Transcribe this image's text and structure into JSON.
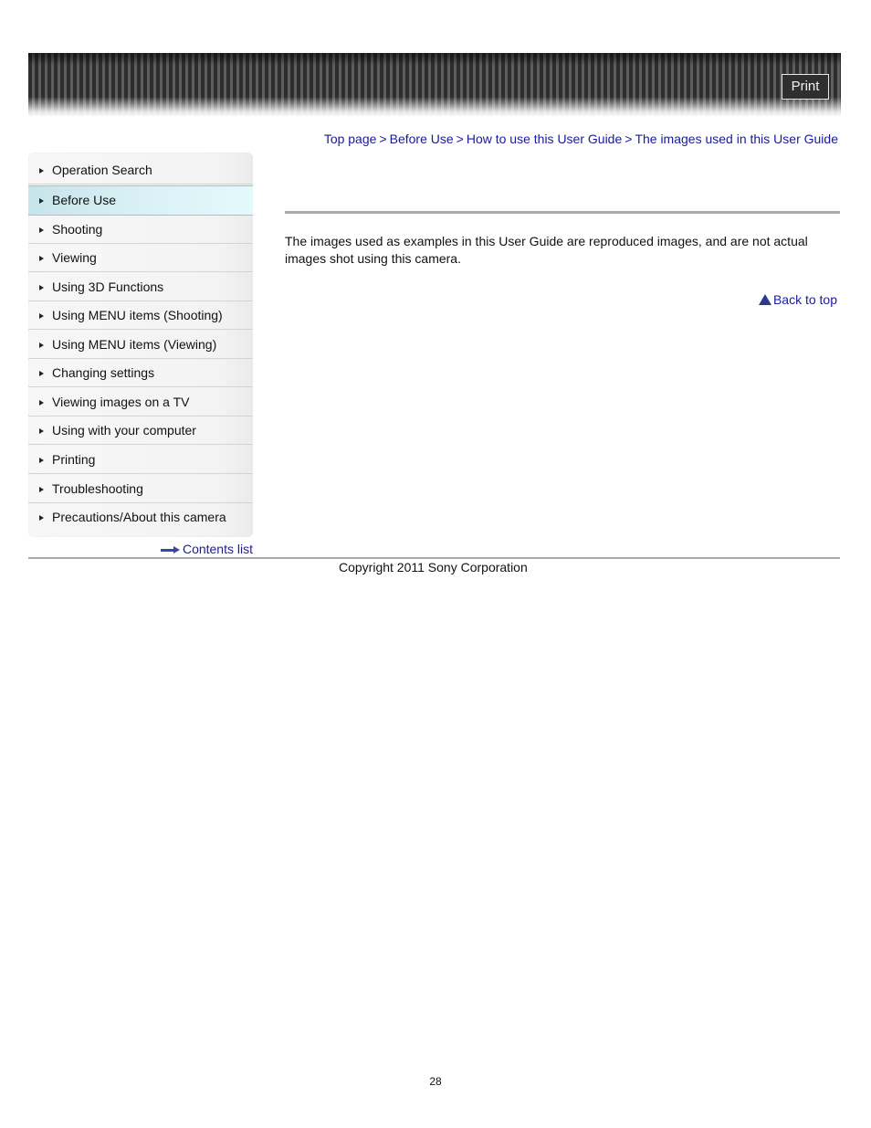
{
  "header": {
    "print_label": "Print"
  },
  "breadcrumb": {
    "items": [
      {
        "label": "Top page"
      },
      {
        "label": "Before Use"
      },
      {
        "label": "How to use this User Guide"
      },
      {
        "label": "The images used in this User Guide"
      }
    ],
    "separator": ">"
  },
  "sidebar": {
    "active_index": 1,
    "items": [
      {
        "label": "Operation Search"
      },
      {
        "label": "Before Use"
      },
      {
        "label": "Shooting"
      },
      {
        "label": "Viewing"
      },
      {
        "label": "Using 3D Functions"
      },
      {
        "label": "Using MENU items (Shooting)"
      },
      {
        "label": "Using MENU items (Viewing)"
      },
      {
        "label": "Changing settings"
      },
      {
        "label": "Viewing images on a TV"
      },
      {
        "label": "Using with your computer"
      },
      {
        "label": "Printing"
      },
      {
        "label": "Troubleshooting"
      },
      {
        "label": "Precautions/About this camera"
      }
    ],
    "contents_list_label": "Contents list"
  },
  "main": {
    "body_text": "The images used as examples in this User Guide are reproduced images, and are not actual images shot using this camera.",
    "back_to_top_label": "Back to top"
  },
  "footer": {
    "copyright": "Copyright 2011 Sony Corporation",
    "page_number": "28"
  },
  "colors": {
    "link": "#1a1a9c",
    "active_nav_border": "#7ad0ee",
    "rule": "#a9a9a9"
  }
}
